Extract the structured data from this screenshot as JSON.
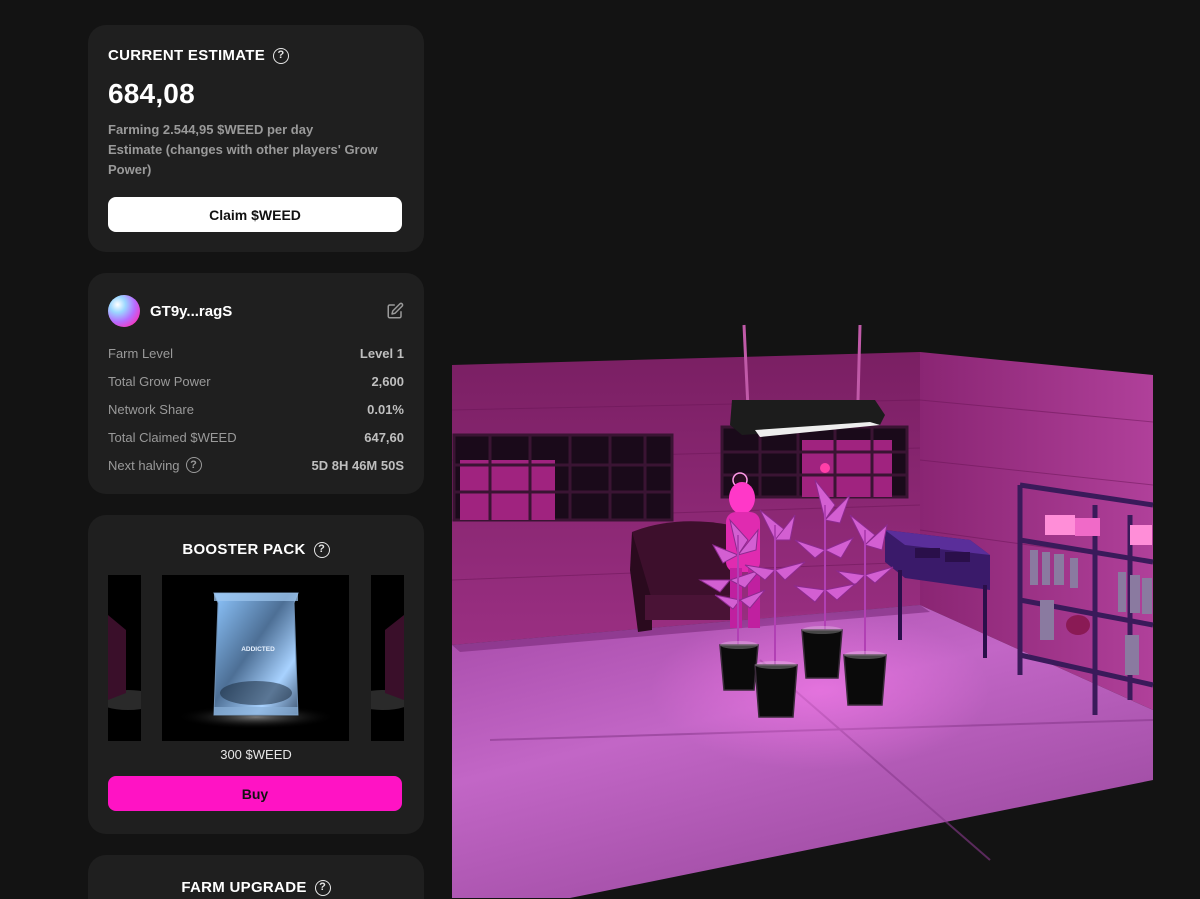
{
  "estimate": {
    "title": "CURRENT ESTIMATE",
    "value": "684,08",
    "farming_line": "Farming 2.544,95 $WEED per day",
    "note_line": "Estimate (changes with other players' Grow Power)",
    "claim_label": "Claim $WEED"
  },
  "profile": {
    "username": "GT9y...ragS",
    "stats": [
      {
        "label": "Farm Level",
        "value": "Level 1"
      },
      {
        "label": "Total Grow Power",
        "value": "2,600"
      },
      {
        "label": "Network Share",
        "value": "0.01%"
      },
      {
        "label": "Total Claimed $WEED",
        "value": "647,60"
      },
      {
        "label": "Next halving",
        "value": "5D 8H 46M 50S"
      }
    ]
  },
  "booster": {
    "title": "BOOSTER PACK",
    "pack_brand": "ADDICTED",
    "price": "300 $WEED",
    "buy_label": "Buy"
  },
  "upgrade": {
    "title": "FARM UPGRADE"
  },
  "colors": {
    "background": "#131313",
    "card": "#1f1f1f",
    "accent_pink": "#ff13c4",
    "muted_text": "#9a9a9a"
  },
  "icons": {
    "help": "question-circle-icon",
    "edit": "pencil-square-icon"
  }
}
